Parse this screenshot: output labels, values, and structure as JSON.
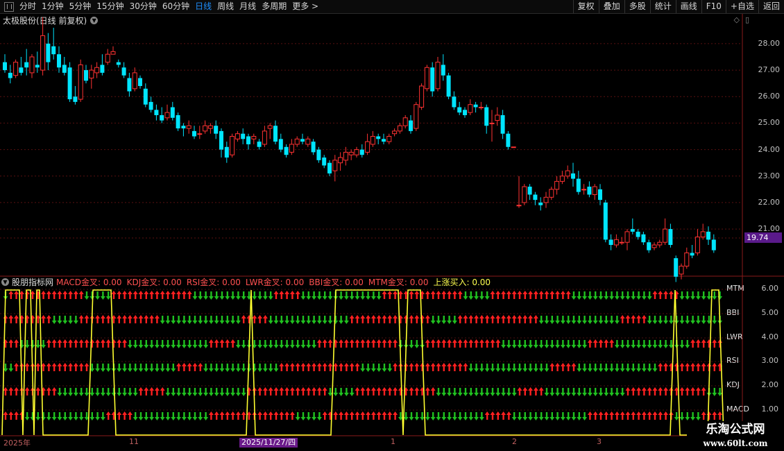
{
  "toolbar": {
    "periods": [
      "分时",
      "1分钟",
      "5分钟",
      "15分钟",
      "30分钟",
      "60分钟",
      "日线",
      "周线",
      "月线",
      "多周期",
      "更多 >"
    ],
    "active": "日线",
    "right": [
      "复权",
      "叠加",
      "多股",
      "统计",
      "画线",
      "F10",
      "+自选",
      "返回"
    ]
  },
  "main_chart": {
    "title": "太极股份(日线 前复权)",
    "last_price": "19.74",
    "price_axis": [
      "28.00",
      "27.00",
      "26.00",
      "25.00",
      "24.00",
      "23.00",
      "22.00",
      "21.00"
    ]
  },
  "indicator": {
    "name": "股朋指标网",
    "items": [
      {
        "label": "MACD金叉:",
        "value": "0.00"
      },
      {
        "label": "KDJ金叉:",
        "value": "0.00"
      },
      {
        "label": "RSI金叉:",
        "value": "0.00"
      },
      {
        "label": "LWR金叉:",
        "value": "0.00"
      },
      {
        "label": "BBI金叉:",
        "value": "0.00"
      },
      {
        "label": "MTM金叉:",
        "value": "0.00"
      },
      {
        "label": "上涨买入:",
        "value": "0.00"
      }
    ],
    "row_labels": [
      "MTM",
      "BBI",
      "LWR",
      "RSI",
      "KDJ",
      "MACD"
    ],
    "scale": [
      "6.00",
      "5.00",
      "4.00",
      "3.00",
      "2.00",
      "1.00"
    ]
  },
  "date_axis": {
    "ticks": [
      "2025年",
      "11",
      "1",
      "2",
      "3"
    ],
    "cursor": "2025/11/27/四"
  },
  "watermark": {
    "line1": "乐淘公式网",
    "line2": "www.60lt.com"
  },
  "colors": {
    "up": "#ff3232",
    "down": "#00e5ff",
    "arrow_up": "#ff2020",
    "arrow_down": "#20c020",
    "signal": "#ffff30",
    "grid": "#5a1010"
  },
  "chart_data": {
    "type": "candlestick",
    "ylim": [
      19.3,
      28.6
    ],
    "candles": [
      [
        27.3,
        27.0,
        27.6,
        26.9
      ],
      [
        26.9,
        26.7,
        27.2,
        26.5
      ],
      [
        26.8,
        27.3,
        27.4,
        26.7
      ],
      [
        27.1,
        26.9,
        27.5,
        26.8
      ],
      [
        27.3,
        27.1,
        27.8,
        26.8
      ],
      [
        26.9,
        27.5,
        27.6,
        26.7
      ],
      [
        27.2,
        27.1,
        27.7,
        26.9
      ],
      [
        27.0,
        28.3,
        29.0,
        26.8
      ],
      [
        28.0,
        27.3,
        28.4,
        27.0
      ],
      [
        27.9,
        27.6,
        28.6,
        27.4
      ],
      [
        27.6,
        27.1,
        27.9,
        26.9
      ],
      [
        27.2,
        26.9,
        27.5,
        26.8
      ],
      [
        27.1,
        25.9,
        27.3,
        25.8
      ],
      [
        26.0,
        25.8,
        26.4,
        25.7
      ],
      [
        25.9,
        27.2,
        27.4,
        25.8
      ],
      [
        27.0,
        26.6,
        27.2,
        26.5
      ],
      [
        26.7,
        27.0,
        27.2,
        26.3
      ],
      [
        26.9,
        27.1,
        27.3,
        26.7
      ],
      [
        27.2,
        26.9,
        27.6,
        26.8
      ],
      [
        27.3,
        27.6,
        27.8,
        27.2
      ],
      [
        27.6,
        27.7,
        27.9,
        27.6
      ],
      [
        27.3,
        27.2,
        27.4,
        27.1
      ],
      [
        27.1,
        26.8,
        27.3,
        26.7
      ],
      [
        26.7,
        26.2,
        26.9,
        26.0
      ],
      [
        26.3,
        26.9,
        27.1,
        26.2
      ],
      [
        26.7,
        26.4,
        26.8,
        26.3
      ],
      [
        26.3,
        25.7,
        26.5,
        25.6
      ],
      [
        25.8,
        25.5,
        26.0,
        25.4
      ],
      [
        25.5,
        25.3,
        25.7,
        25.1
      ],
      [
        25.3,
        25.1,
        25.6,
        25.0
      ],
      [
        25.2,
        25.4,
        25.7,
        25.1
      ],
      [
        25.6,
        25.2,
        25.8,
        25.1
      ],
      [
        25.3,
        24.8,
        25.4,
        24.7
      ],
      [
        24.9,
        24.8,
        25.0,
        24.5
      ],
      [
        24.8,
        24.9,
        25.1,
        24.6
      ],
      [
        24.7,
        24.5,
        24.9,
        24.4
      ],
      [
        24.6,
        24.6,
        24.9,
        24.4
      ],
      [
        24.7,
        24.9,
        25.1,
        24.6
      ],
      [
        24.8,
        24.9,
        25.0,
        24.6
      ],
      [
        24.9,
        24.6,
        25.1,
        24.4
      ],
      [
        24.7,
        24.0,
        24.8,
        23.7
      ],
      [
        24.1,
        23.7,
        24.3,
        23.5
      ],
      [
        23.8,
        24.5,
        24.6,
        23.7
      ],
      [
        24.4,
        24.6,
        24.7,
        24.3
      ],
      [
        24.6,
        24.4,
        24.8,
        24.2
      ],
      [
        24.5,
        24.2,
        24.6,
        24.0
      ],
      [
        24.4,
        24.5,
        24.6,
        24.2
      ],
      [
        24.3,
        24.1,
        24.4,
        24.0
      ],
      [
        24.2,
        24.7,
        24.9,
        24.1
      ],
      [
        24.8,
        24.9,
        25.0,
        24.4
      ],
      [
        24.9,
        24.3,
        25.1,
        24.2
      ],
      [
        24.4,
        24.0,
        24.6,
        23.9
      ],
      [
        24.1,
        23.8,
        24.2,
        23.7
      ],
      [
        23.9,
        24.2,
        24.4,
        23.8
      ],
      [
        24.2,
        24.4,
        24.5,
        24.1
      ],
      [
        24.4,
        24.3,
        24.6,
        24.2
      ],
      [
        24.2,
        24.4,
        24.5,
        24.1
      ],
      [
        24.3,
        23.9,
        24.4,
        23.8
      ],
      [
        24.0,
        23.6,
        24.1,
        23.5
      ],
      [
        23.7,
        23.4,
        23.8,
        23.3
      ],
      [
        23.5,
        23.1,
        23.6,
        23.0
      ],
      [
        23.2,
        23.6,
        23.8,
        22.8
      ],
      [
        23.5,
        23.7,
        23.9,
        23.2
      ],
      [
        23.6,
        23.9,
        24.1,
        23.4
      ],
      [
        23.8,
        23.9,
        24.0,
        23.6
      ],
      [
        23.8,
        24.0,
        24.1,
        23.7
      ],
      [
        24.0,
        23.8,
        24.2,
        23.7
      ],
      [
        23.9,
        24.3,
        24.6,
        23.8
      ],
      [
        24.2,
        24.5,
        24.7,
        24.1
      ],
      [
        24.5,
        24.4,
        24.6,
        24.2
      ],
      [
        24.4,
        24.3,
        24.6,
        24.2
      ],
      [
        24.3,
        24.5,
        24.6,
        24.2
      ],
      [
        24.6,
        24.7,
        24.8,
        24.5
      ],
      [
        24.7,
        24.9,
        25.0,
        24.6
      ],
      [
        24.9,
        25.2,
        25.3,
        24.8
      ],
      [
        25.1,
        24.7,
        25.3,
        24.6
      ],
      [
        24.8,
        25.7,
        25.8,
        24.7
      ],
      [
        25.6,
        26.4,
        26.5,
        25.5
      ],
      [
        26.3,
        27.1,
        27.2,
        26.2
      ],
      [
        27.1,
        26.2,
        27.3,
        26.0
      ],
      [
        26.3,
        27.3,
        27.5,
        26.2
      ],
      [
        27.2,
        26.8,
        27.6,
        26.6
      ],
      [
        26.8,
        26.0,
        26.9,
        25.9
      ],
      [
        26.0,
        25.6,
        26.2,
        25.5
      ],
      [
        25.6,
        25.4,
        25.8,
        25.3
      ],
      [
        25.5,
        25.3,
        25.6,
        25.2
      ],
      [
        25.4,
        25.7,
        25.9,
        25.3
      ],
      [
        25.7,
        25.6,
        25.8,
        25.4
      ],
      [
        25.6,
        25.6,
        25.8,
        25.5
      ],
      [
        25.6,
        24.9,
        25.7,
        24.6
      ],
      [
        25.0,
        25.0,
        25.5,
        24.3
      ],
      [
        25.1,
        25.3,
        25.6,
        24.9
      ],
      [
        25.3,
        24.6,
        25.5,
        24.4
      ],
      [
        24.6,
        24.1,
        24.7,
        24.0
      ],
      [
        24.1,
        24.1,
        24.1,
        24.1
      ],
      [
        21.9,
        21.9,
        23.0,
        21.8
      ],
      [
        22.0,
        22.6,
        22.7,
        21.9
      ],
      [
        22.6,
        22.3,
        22.7,
        22.1
      ],
      [
        22.3,
        22.1,
        22.4,
        21.9
      ],
      [
        22.0,
        21.9,
        22.2,
        21.7
      ],
      [
        22.0,
        22.2,
        22.4,
        21.8
      ],
      [
        22.2,
        22.5,
        22.6,
        22.1
      ],
      [
        22.5,
        22.8,
        23.0,
        22.3
      ],
      [
        22.8,
        23.0,
        23.2,
        22.7
      ],
      [
        23.0,
        23.2,
        23.4,
        22.9
      ],
      [
        23.1,
        22.9,
        23.5,
        22.6
      ],
      [
        22.9,
        22.4,
        23.2,
        22.3
      ],
      [
        22.5,
        22.5,
        22.7,
        22.3
      ],
      [
        22.6,
        22.3,
        22.8,
        22.2
      ],
      [
        22.3,
        22.6,
        22.7,
        22.1
      ],
      [
        22.5,
        22.1,
        22.7,
        21.9
      ],
      [
        22.0,
        20.6,
        22.1,
        20.5
      ],
      [
        20.6,
        20.4,
        20.8,
        20.2
      ],
      [
        20.4,
        20.6,
        20.8,
        20.3
      ],
      [
        20.5,
        20.5,
        20.7,
        20.4
      ],
      [
        20.5,
        20.9,
        21.0,
        20.2
      ],
      [
        21.0,
        20.9,
        21.4,
        20.8
      ],
      [
        20.9,
        20.7,
        21.0,
        20.6
      ],
      [
        20.8,
        20.5,
        20.9,
        20.4
      ],
      [
        20.5,
        20.2,
        20.6,
        20.1
      ],
      [
        20.3,
        20.4,
        20.5,
        20.2
      ],
      [
        20.4,
        20.5,
        20.6,
        20.3
      ],
      [
        20.5,
        21.0,
        21.4,
        20.4
      ],
      [
        21.0,
        20.4,
        21.2,
        20.3
      ],
      [
        19.9,
        19.2,
        20.0,
        19.0
      ],
      [
        19.3,
        19.6,
        19.7,
        19.1
      ],
      [
        19.6,
        20.1,
        20.3,
        19.5
      ],
      [
        20.1,
        20.0,
        20.4,
        19.9
      ],
      [
        20.1,
        20.7,
        21.0,
        20.0
      ],
      [
        20.7,
        20.9,
        21.2,
        20.6
      ],
      [
        20.9,
        20.6,
        21.1,
        20.4
      ],
      [
        20.6,
        20.2,
        20.8,
        20.1
      ]
    ]
  }
}
